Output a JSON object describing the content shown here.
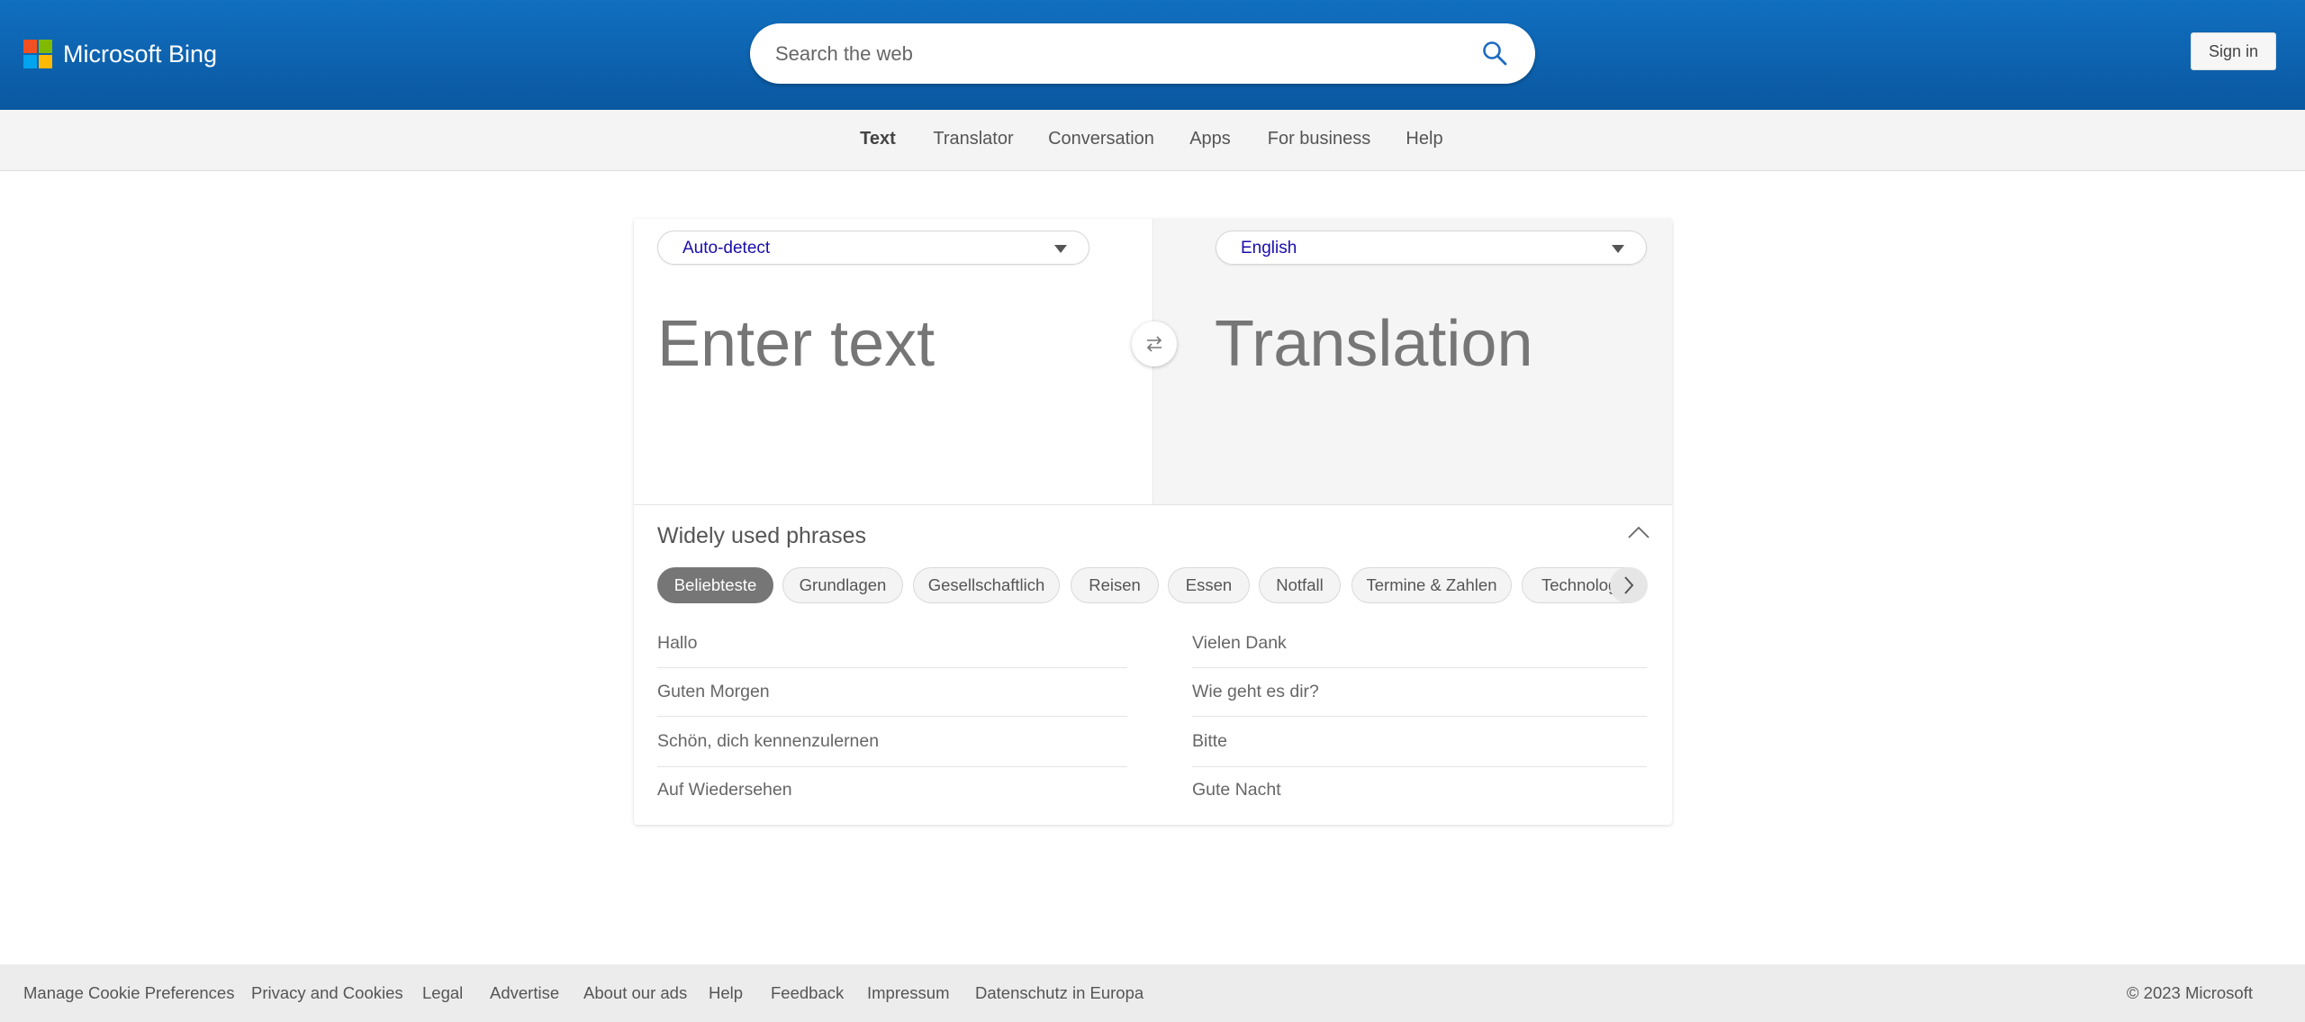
{
  "header": {
    "brand": "Microsoft Bing",
    "search_placeholder": "Search the web",
    "sign_in": "Sign in",
    "colors": {
      "bar": "#0f68b8",
      "logo": [
        "#f25022",
        "#7fba00",
        "#00a4ef",
        "#ffb900"
      ]
    }
  },
  "nav": {
    "items": [
      "Text",
      "Translator",
      "Conversation",
      "Apps",
      "For business",
      "Help"
    ],
    "active": "Text"
  },
  "translator": {
    "source_lang": "Auto-detect",
    "target_lang": "English",
    "input_placeholder": "Enter text",
    "output_placeholder": "Translation"
  },
  "phrases": {
    "title": "Widely used phrases",
    "categories": [
      "Beliebteste",
      "Grundlagen",
      "Gesellschaftlich",
      "Reisen",
      "Essen",
      "Notfall",
      "Termine & Zahlen",
      "Technolog"
    ],
    "active_category": "Beliebteste",
    "left": [
      "Hallo",
      "Guten Morgen",
      "Schön, dich kennenzulernen",
      "Auf Wiedersehen"
    ],
    "right": [
      "Vielen Dank",
      "Wie geht es dir?",
      "Bitte",
      "Gute Nacht"
    ]
  },
  "footer": {
    "links": [
      "Manage Cookie Preferences",
      "Privacy and Cookies",
      "Legal",
      "Advertise",
      "About our ads",
      "Help",
      "Feedback",
      "Impressum",
      "Datenschutz in Europa"
    ],
    "copyright": "© 2023 Microsoft"
  }
}
